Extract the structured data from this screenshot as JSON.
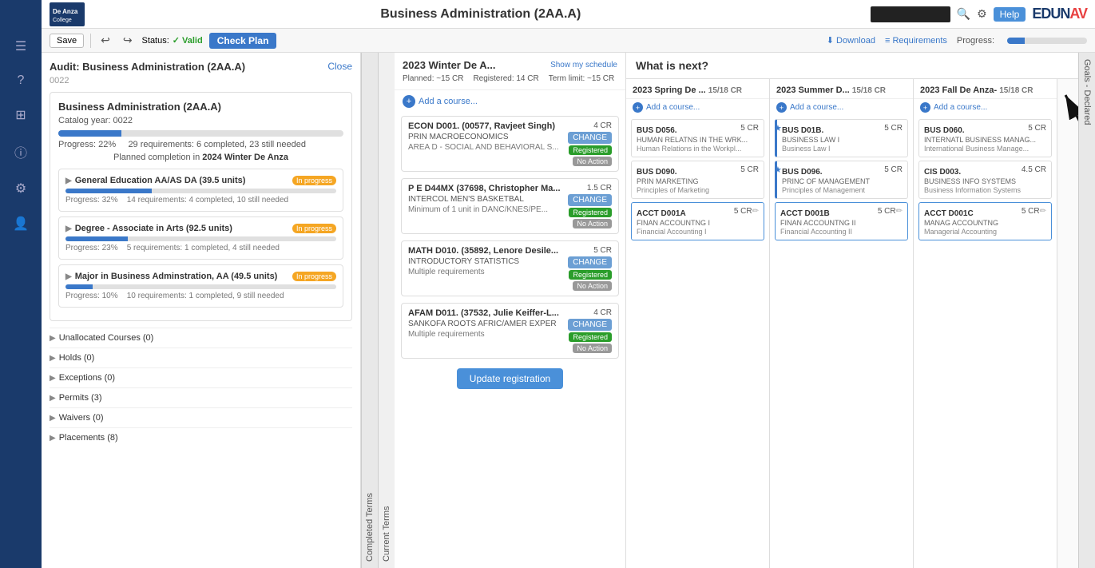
{
  "topNav": {
    "logoAlt": "De Anza College",
    "title": "Business Administration (2AA.A)",
    "helpLabel": "Help",
    "edunavLogo": "EDUNAV"
  },
  "toolbar": {
    "saveLabel": "Save",
    "undoIcon": "↩",
    "redoIcon": "↪",
    "statusLabel": "Status:",
    "statusValue": "Valid",
    "checkPlanLabel": "Check Plan",
    "downloadLabel": "Download",
    "requirementsLabel": "Requirements",
    "progressLabel": "Progress:",
    "progressPercent": 22
  },
  "sidebarIcons": [
    "☰",
    "?",
    "⊞",
    "?",
    "⚙",
    "👤"
  ],
  "auditPanel": {
    "title": "Audit: Business Administration (2AA.A)",
    "closeLabel": "Close",
    "id": "0022",
    "programTitle": "Business Administration (2AA.A)",
    "catalogYearLabel": "Catalog year:",
    "catalogYear": "0022",
    "overallProgress": 22,
    "progressText": "Progress: 22%",
    "requirementsText": "29 requirements: 6 completed, 23 still needed",
    "completionText": "Planned completion in",
    "completionDate": "2024 Winter De Anza",
    "sections": [
      {
        "id": "gen-ed",
        "label": "General Education AA/AS DA (39.5 units)",
        "badge": "In progress",
        "progress": 32,
        "statsText": "Progress: 32%",
        "reqText": "14 requirements: 4 completed, 10 still needed"
      },
      {
        "id": "degree",
        "label": "Degree - Associate in Arts (92.5 units)",
        "badge": "In progress",
        "progress": 23,
        "statsText": "Progress: 23%",
        "reqText": "5 requirements: 1 completed, 4 still needed"
      },
      {
        "id": "major",
        "label": "Major in Business Adminstration, AA (49.5 units)",
        "badge": "In progress",
        "progress": 10,
        "statsText": "Progress: 10%",
        "reqText": "10 requirements: 1 completed, 9 still needed"
      }
    ],
    "collapsibles": [
      {
        "label": "Unallocated Courses (0)"
      },
      {
        "label": "Holds (0)"
      },
      {
        "label": "Exceptions (0)"
      },
      {
        "label": "Permits (3)"
      },
      {
        "label": "Waivers (0)"
      },
      {
        "label": "Placements (8)"
      }
    ]
  },
  "currentTerm": {
    "name": "2023 Winter De A...",
    "showMySchedule": "Show my schedule",
    "planned": "Planned: ~15 CR",
    "registered": "Registered: 14 CR",
    "termLimit": "Term limit: ~15 CR",
    "addCourse": "Add a course...",
    "courses": [
      {
        "id": "ECON D001.",
        "fullId": "ECON D001. (00577, Ravjeet Singh)",
        "name": "PRIN MACROECONOMICS",
        "note": "AREA D - SOCIAL AND BEHAVIORAL S...",
        "credits": "4 CR",
        "changeLabel": "CHANGE",
        "statusLabel": "Registered",
        "actionLabel": "No Action"
      },
      {
        "id": "P E D44MX",
        "fullId": "P E D44MX (37698, Christopher Ma...",
        "name": "INTERCOL MEN'S BASKETBAL",
        "note": "Minimum of 1 unit in DANC/KNES/PE...",
        "credits": "1.5 CR",
        "changeLabel": "CHANGE",
        "statusLabel": "Registered",
        "actionLabel": "No Action"
      },
      {
        "id": "MATH D010.",
        "fullId": "MATH D010. (35892, Lenore Desile...",
        "name": "INTRODUCTORY STATISTICS",
        "note": "Multiple requirements",
        "credits": "5 CR",
        "changeLabel": "CHANGE",
        "statusLabel": "Registered",
        "actionLabel": "No Action"
      },
      {
        "id": "AFAM D011.",
        "fullId": "AFAM D011. (37532, Julie Keiffer-L...",
        "name": "SANKOFA ROOTS AFRIC/AMER EXPER",
        "note": "Multiple requirements",
        "credits": "4 CR",
        "changeLabel": "CHANGE",
        "statusLabel": "Registered",
        "actionLabel": "No Action"
      }
    ],
    "updateRegLabel": "Update registration"
  },
  "whatIsNext": {
    "header": "What is next?",
    "addCourse": "Add a course...",
    "terms": [
      {
        "name": "2023 Spring De ...",
        "meta": "15/18 CR",
        "courses": [
          {
            "id": "BUS D056.",
            "cr": "5 CR",
            "name": "HUMAN RELATNS IN THE WRK...",
            "desc": "Human Relations in the Workpl...",
            "starred": false,
            "editable": false
          },
          {
            "id": "BUS D090.",
            "cr": "5 CR",
            "name": "PRIN MARKETING",
            "desc": "Principles of Marketing",
            "starred": false,
            "editable": false
          },
          {
            "id": "ACCT D001A",
            "cr": "5 CR",
            "name": "FINAN ACCOUNTNG I",
            "desc": "Financial Accounting I",
            "starred": false,
            "editable": true
          }
        ]
      },
      {
        "name": "2023 Summer D...",
        "meta": "15/18 CR",
        "courses": [
          {
            "id": "BUS D01B.",
            "cr": "5 CR",
            "name": "BUSINESS LAW I",
            "desc": "Business Law I",
            "starred": true,
            "editable": false
          },
          {
            "id": "BUS D096.",
            "cr": "5 CR",
            "name": "PRINC OF MANAGEMENT",
            "desc": "Principles of Management",
            "starred": true,
            "editable": false
          },
          {
            "id": "ACCT D001B",
            "cr": "5 CR",
            "name": "FINAN ACCOUNTNG II",
            "desc": "Financial Accounting II",
            "starred": false,
            "editable": true
          }
        ]
      },
      {
        "name": "2023 Fall De Anza-",
        "meta": "15/18 CR",
        "courses": [
          {
            "id": "BUS D060.",
            "cr": "5 CR",
            "name": "INTERNATL BUSINESS MANAG...",
            "desc": "International Business Manage...",
            "starred": false,
            "editable": false
          },
          {
            "id": "CIS D003.",
            "cr": "4.5 CR",
            "name": "BUSINESS INFO SYSTEMS",
            "desc": "Business Information Systems",
            "starred": false,
            "editable": false
          },
          {
            "id": "ACCT D001C",
            "cr": "5 CR",
            "name": "MANAG ACCOUNTNG",
            "desc": "Managerial Accounting",
            "starred": false,
            "editable": true
          }
        ]
      }
    ]
  },
  "goalsLabel": "Goals - Declared"
}
